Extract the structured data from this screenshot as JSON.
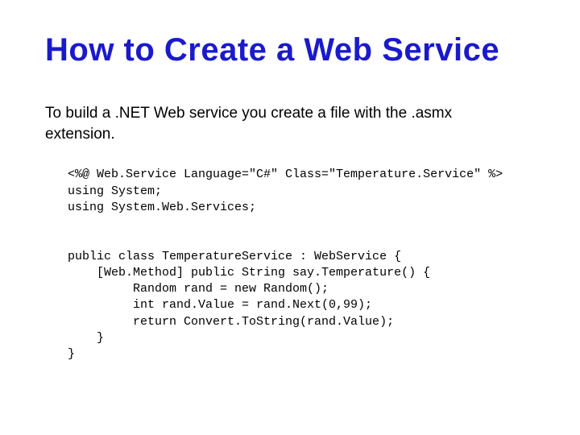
{
  "title": "How to Create a Web Service",
  "subtitle": "To build a .NET Web service you create a file with the .asmx extension.",
  "code": "<%@ Web.Service Language=\"C#\" Class=\"Temperature.Service\" %>\nusing System;\nusing System.Web.Services;\n\n\npublic class TemperatureService : WebService {\n    [Web.Method] public String say.Temperature() {\n         Random rand = new Random();\n         int rand.Value = rand.Next(0,99);\n         return Convert.ToString(rand.Value);\n    }\n}"
}
